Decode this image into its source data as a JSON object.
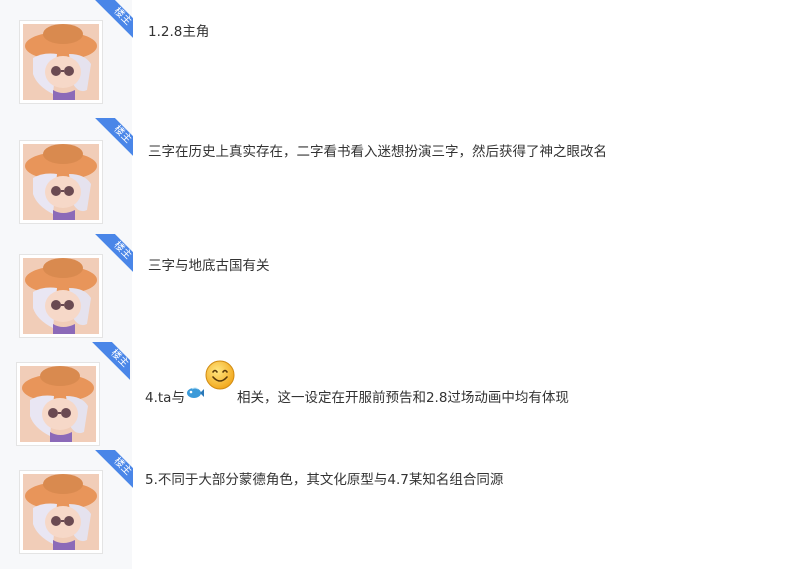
{
  "posts": [
    {
      "badge": "楼主",
      "segments": [
        {
          "type": "text",
          "value": "1.2.8主角"
        }
      ]
    },
    {
      "badge": "楼主",
      "segments": [
        {
          "type": "text",
          "value": "三字在历史上真实存在，二字看书看入迷想扮演三字，然后获得了神之眼改名"
        }
      ]
    },
    {
      "badge": "楼主",
      "segments": [
        {
          "type": "text",
          "value": "三字与地底古国有关"
        }
      ]
    },
    {
      "badge": "楼主",
      "segments": [
        {
          "type": "text",
          "value": "4.ta与"
        },
        {
          "type": "icon",
          "name": "fish-emoji-icon"
        },
        {
          "type": "icon",
          "name": "smiley-emoji-icon"
        },
        {
          "type": "text",
          "value": "相关，这一设定在开服前预告和2.8过场动画中均有体现"
        }
      ]
    },
    {
      "badge": "楼主",
      "segments": [
        {
          "type": "text",
          "value": "5.不同于大部分蒙德角色，其文化原型与4.7某知名组合同源"
        }
      ]
    }
  ],
  "colors": {
    "badge": "#4a86e8",
    "rail": "#f7f8fa",
    "text": "#333333"
  }
}
